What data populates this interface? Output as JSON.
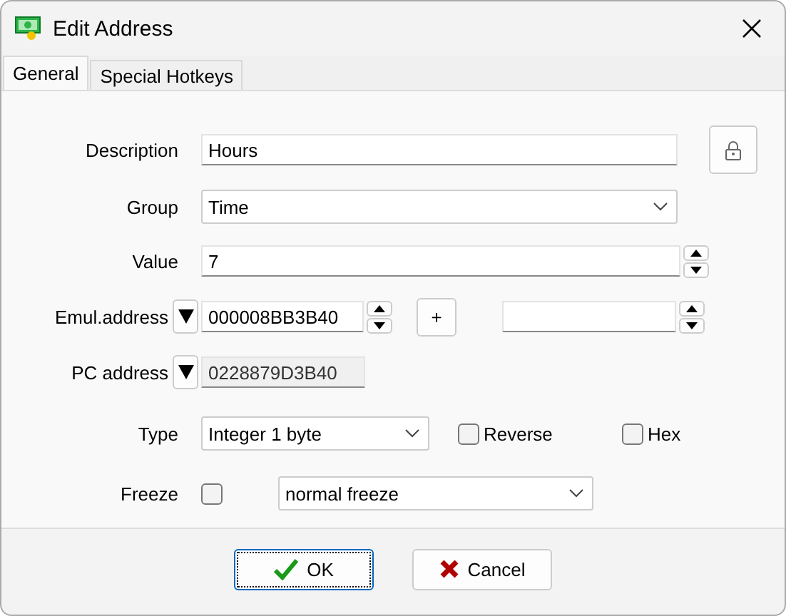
{
  "window": {
    "title": "Edit Address"
  },
  "tabs": [
    {
      "label": "General",
      "selected": true
    },
    {
      "label": "Special Hotkeys",
      "selected": false
    }
  ],
  "description": {
    "label": "Description",
    "value": "Hours"
  },
  "group": {
    "label": "Group",
    "value": "Time"
  },
  "value": {
    "label": "Value",
    "value": "7"
  },
  "emul_address": {
    "label": "Emul.address",
    "value": "000008BB3B40",
    "plus": "+"
  },
  "pc_address": {
    "label": "PC address",
    "value": "0228879D3B40",
    "disabled": true
  },
  "type": {
    "label": "Type",
    "value": "Integer 1 byte"
  },
  "options": [
    {
      "label": "Reverse",
      "checked": false
    },
    {
      "label": "Hex",
      "checked": false
    }
  ],
  "freeze": {
    "label": "Freeze",
    "checked": false,
    "mode": "normal freeze"
  },
  "buttons": [
    {
      "label": "OK",
      "kind": "ok",
      "default": true
    },
    {
      "label": "Cancel",
      "kind": "cancel",
      "default": false
    }
  ]
}
